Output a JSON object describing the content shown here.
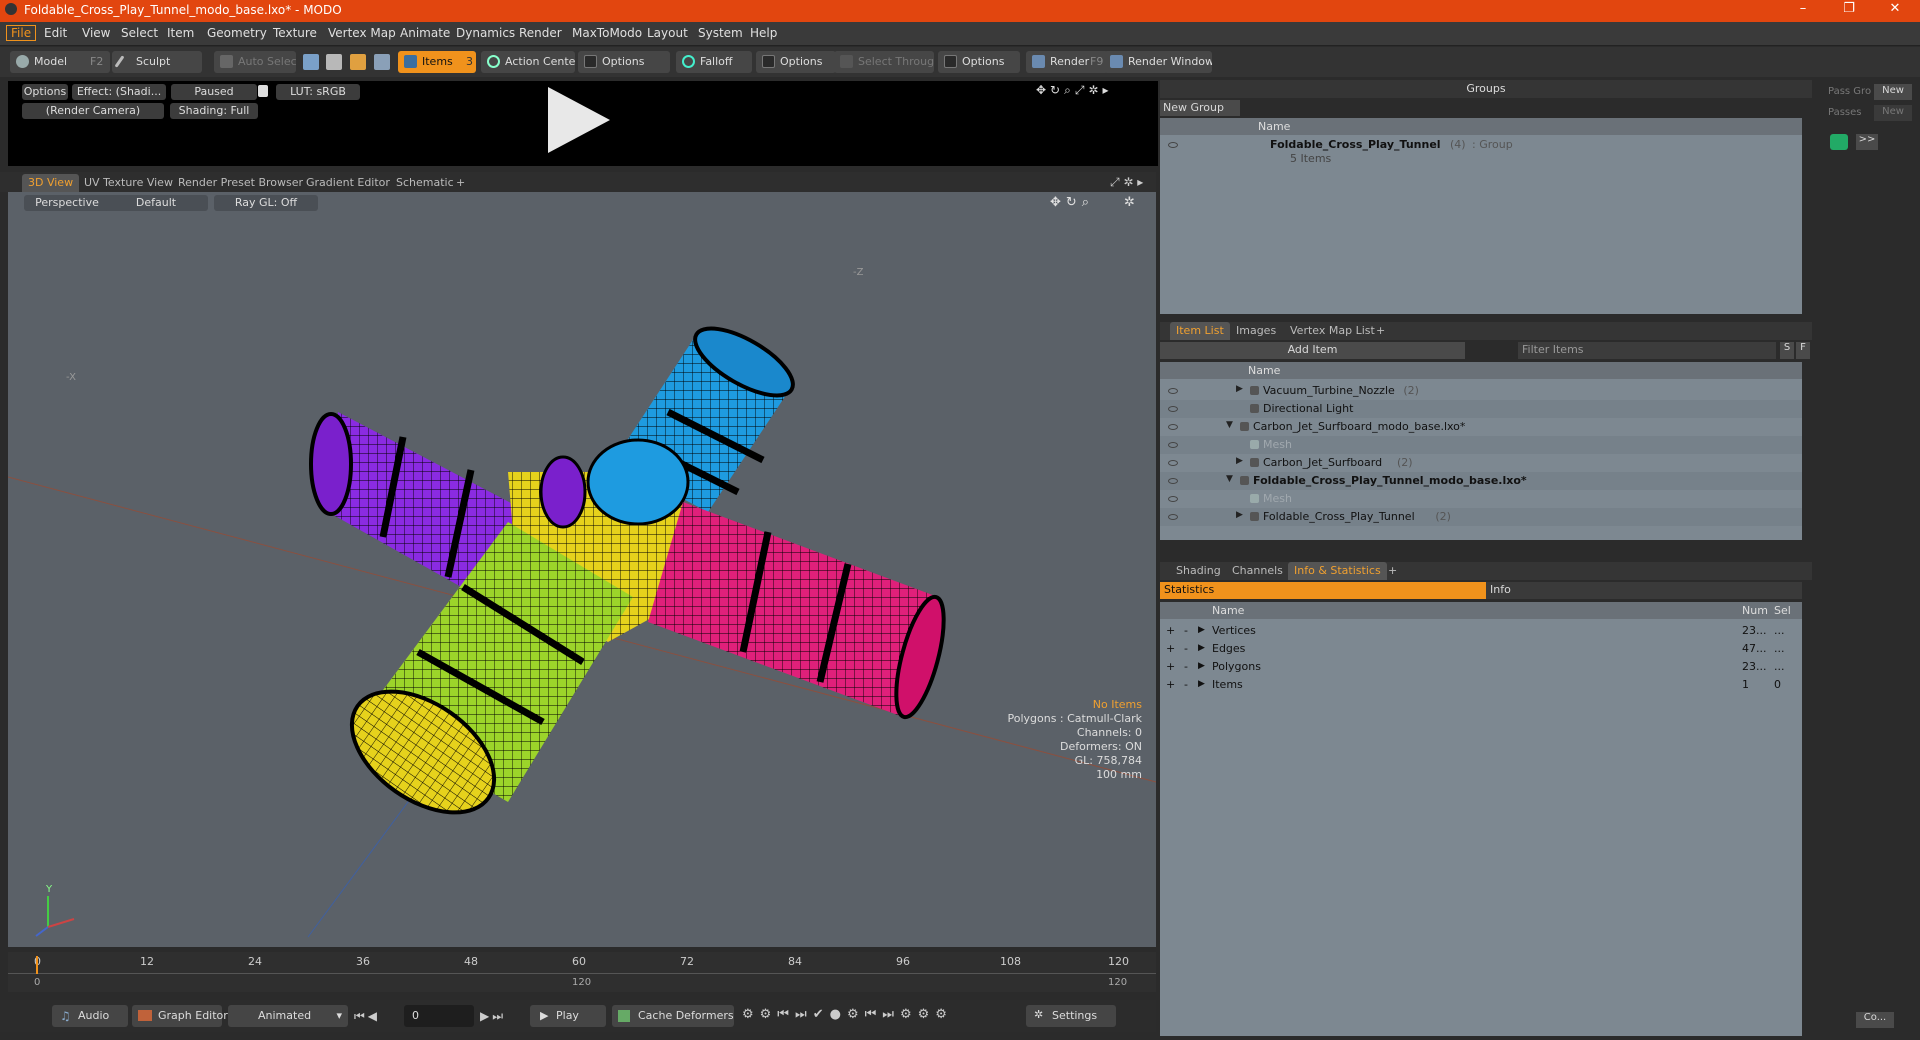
{
  "window": {
    "title": "Foldable_Cross_Play_Tunnel_modo_base.lxo* - MODO",
    "min": "–",
    "max": "❐",
    "close": "✕"
  },
  "menu": [
    "File",
    "Edit",
    "View",
    "Select",
    "Item",
    "Geometry",
    "Texture",
    "Vertex Map",
    "Animate",
    "Dynamics",
    "Render",
    "MaxToModo",
    "Layout",
    "System",
    "Help"
  ],
  "toolbar": {
    "model": "Model",
    "model_key": "F2",
    "sculpt": "Sculpt",
    "auto_select": "Auto Select",
    "items": "Items",
    "items_key": "3",
    "action_center": "Action Center",
    "options1": "Options",
    "falloff": "Falloff",
    "options2": "Options",
    "select_through": "Select Through",
    "options3": "Options",
    "render": "Render",
    "render_key": "F9",
    "render_window": "Render Window"
  },
  "preview": {
    "options": "Options",
    "effect": "Effect: (Shadi...",
    "paused": "Paused",
    "lut": "LUT: sRGB",
    "camera": "(Render Camera)",
    "shading": "Shading: Full"
  },
  "viewport_tabs": [
    "3D View",
    "UV Texture View",
    "Render Preset Browser",
    "Gradient Editor",
    "Schematic",
    "+"
  ],
  "viewport": {
    "perspective": "Perspective",
    "default": "Default",
    "raygl": "Ray GL: Off",
    "axis_z": "-Z",
    "axis_x": "-X",
    "info": {
      "no_items": "No Items",
      "polygons": "Polygons : Catmull-Clark",
      "channels": "Channels: 0",
      "deformers": "Deformers: ON",
      "gl": "GL: 758,784",
      "scale": "100 mm"
    },
    "axis_y_label": "Y"
  },
  "timeline": {
    "ticks": [
      "0",
      "12",
      "24",
      "36",
      "48",
      "60",
      "72",
      "84",
      "96",
      "108",
      "120"
    ],
    "lower": [
      "0",
      "120",
      "120"
    ]
  },
  "bottombar": {
    "audio": "Audio",
    "graph_editor": "Graph Editor",
    "animated": "Animated",
    "frame": "0",
    "play": "Play",
    "cache": "Cache Deformers",
    "settings": "Settings"
  },
  "groups": {
    "title": "Groups",
    "new_group": "New Group",
    "col_name": "Name",
    "row_name": "Foldable_Cross_Play_Tunnel",
    "row_count": "(4)",
    "row_type": ": Group",
    "row_sub": "5 Items"
  },
  "right_col": {
    "pass_group": "Pass Gro",
    "new1": "New",
    "passes": "Passes",
    "new2": "New",
    "more": ">>",
    "co": "Co..."
  },
  "itemlist": {
    "tabs": [
      "Item List",
      "Images",
      "Vertex Map List",
      "+"
    ],
    "add_item": "Add Item",
    "filter": "Filter Items",
    "s": "S",
    "f": "F",
    "col_name": "Name",
    "rows": [
      {
        "label": "Vacuum_Turbine_Nozzle",
        "count": "(2)",
        "indent": 90,
        "arrow": "▶",
        "bold": false,
        "dim": false
      },
      {
        "label": "Directional Light",
        "count": "",
        "indent": 90,
        "arrow": "",
        "bold": false,
        "dim": false
      },
      {
        "label": "Carbon_Jet_Surfboard_modo_base.lxo*",
        "count": "",
        "indent": 80,
        "arrow": "▼",
        "bold": false,
        "dim": false
      },
      {
        "label": "Mesh",
        "count": "",
        "indent": 90,
        "arrow": "",
        "bold": false,
        "dim": true
      },
      {
        "label": "Carbon_Jet_Surfboard",
        "count": "(2)",
        "indent": 90,
        "arrow": "▶",
        "bold": false,
        "dim": false
      },
      {
        "label": "Foldable_Cross_Play_Tunnel_modo_base.lxo*",
        "count": "",
        "indent": 80,
        "arrow": "▼",
        "bold": true,
        "dim": false
      },
      {
        "label": "Mesh",
        "count": "",
        "indent": 90,
        "arrow": "",
        "bold": false,
        "dim": true
      },
      {
        "label": "Foldable_Cross_Play_Tunnel",
        "count": "(2)",
        "indent": 90,
        "arrow": "▶",
        "bold": false,
        "dim": false
      }
    ]
  },
  "stats": {
    "tabs": [
      "Shading",
      "Channels",
      "Info & Statistics",
      "+"
    ],
    "statistics": "Statistics",
    "info": "Info",
    "col_name": "Name",
    "col_num": "Num",
    "col_sel": "Sel",
    "rows": [
      {
        "name": "Vertices",
        "num": "23...",
        "sel": "..."
      },
      {
        "name": "Edges",
        "num": "47...",
        "sel": "..."
      },
      {
        "name": "Polygons",
        "num": "23...",
        "sel": "..."
      },
      {
        "name": "Items",
        "num": "1",
        "sel": "0"
      }
    ]
  },
  "colors": {
    "accent": "#f0921c",
    "title": "#e2460f",
    "purple": "#8a2be2",
    "blue": "#1e9be0",
    "pink": "#e0207a",
    "green": "#9cd42a",
    "yellow": "#e6d21c"
  }
}
